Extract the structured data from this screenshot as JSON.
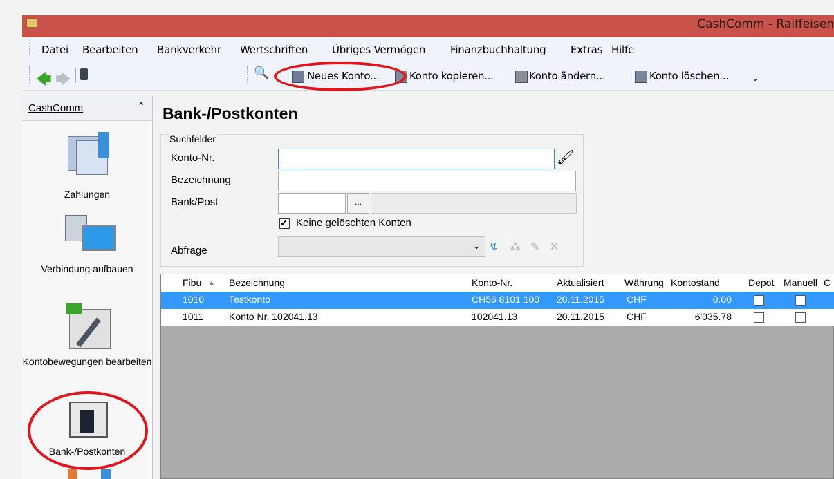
{
  "window": {
    "title": "CashComm - Raiffeisen"
  },
  "menu": [
    "Datei",
    "Bearbeiten",
    "Bankverkehr",
    "Wertschriften",
    "Übriges Vermögen",
    "Finanzbuchhaltung",
    "Extras",
    "Hilfe"
  ],
  "toolbar": {
    "new_account": "Neues Konto...",
    "copy_account": "Konto kopieren...",
    "edit_account": "Konto ändern...",
    "delete_account": "Konto löschen..."
  },
  "sidebar": {
    "header": "CashComm",
    "items": [
      {
        "label": "Zahlungen",
        "icon": "payments-icon"
      },
      {
        "label": "Verbindung aufbauen",
        "icon": "connect-icon"
      },
      {
        "label": "Kontobewegungen bearbeiten",
        "icon": "transactions-icon"
      },
      {
        "label": "Bank-/Postkonten",
        "icon": "bank-icon"
      }
    ]
  },
  "page": {
    "title": "Bank-/Postkonten"
  },
  "search": {
    "group_title": "Suchfelder",
    "konto_label": "Konto-Nr.",
    "bezeichnung_label": "Bezeichnung",
    "bank_label": "Bank/Post",
    "browse_button": "...",
    "checkbox_label": "Keine gelöschten Konten",
    "checkbox_checked": true,
    "abfrage_label": "Abfrage"
  },
  "grid": {
    "columns": [
      "Fibu",
      "Bezeichnung",
      "Konto-Nr.",
      "Aktualisiert",
      "Währung",
      "Kontostand",
      "Depot",
      "Manuell"
    ],
    "rows": [
      {
        "fibu": "1010",
        "bezeichnung": "Testkonto",
        "konto": "CH56 8101 100",
        "aktualisiert": "20.11.2015",
        "waehrung": "CHF",
        "kontostand": "0.00",
        "selected": true
      },
      {
        "fibu": "1011",
        "bezeichnung": "Konto Nr. 102041.13",
        "konto": "102041.13",
        "aktualisiert": "20.11.2015",
        "waehrung": "CHF",
        "kontostand": "6'035.78",
        "selected": false
      }
    ]
  },
  "colors": {
    "titlebar": "#c9524a",
    "highlight": "#e0161c",
    "selection": "#3399ff"
  }
}
